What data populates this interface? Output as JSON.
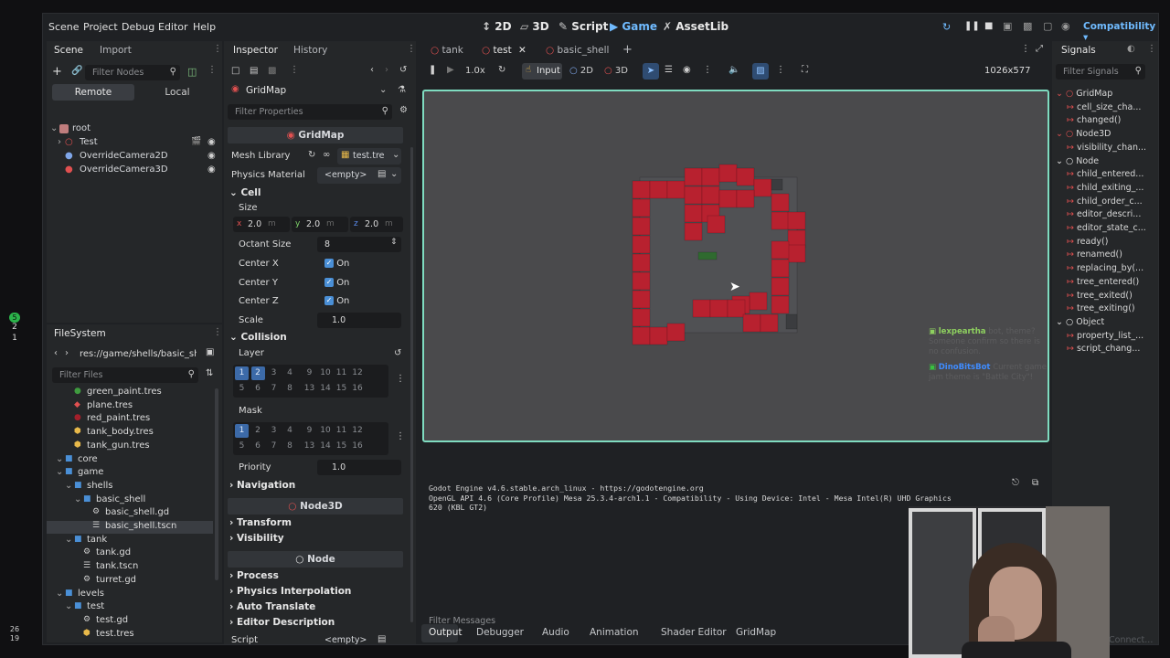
{
  "menu": [
    "Scene",
    "Project",
    "Debug",
    "Editor",
    "Help"
  ],
  "workspaces": [
    {
      "label": "2D",
      "icon": "2d-icon"
    },
    {
      "label": "3D",
      "icon": "3d-icon"
    },
    {
      "label": "Script",
      "icon": "script-icon"
    },
    {
      "label": "Game",
      "icon": "game-icon"
    },
    {
      "label": "AssetLib",
      "icon": "assetlib-icon"
    }
  ],
  "renderer": "Compatibility",
  "scene_dock": {
    "tabs": [
      "Scene",
      "Import"
    ],
    "filter_placeholder": "Filter Nodes",
    "remote_label": "Remote",
    "local_label": "Local",
    "nodes": [
      {
        "label": "root",
        "depth": 0
      },
      {
        "label": "Test",
        "depth": 1
      },
      {
        "label": "OverrideCamera2D",
        "depth": 1
      },
      {
        "label": "OverrideCamera3D",
        "depth": 1
      }
    ]
  },
  "filesystem": {
    "title": "FileSystem",
    "path": "res://game/shells/basic_she",
    "filter_placeholder": "Filter Files",
    "items": [
      {
        "label": "green_paint.tres",
        "depth": 2,
        "kind": "material-green"
      },
      {
        "label": "plane.tres",
        "depth": 2,
        "kind": "mesh"
      },
      {
        "label": "red_paint.tres",
        "depth": 2,
        "kind": "material-red"
      },
      {
        "label": "tank_body.tres",
        "depth": 2,
        "kind": "resource"
      },
      {
        "label": "tank_gun.tres",
        "depth": 2,
        "kind": "resource"
      },
      {
        "label": "core",
        "depth": 1,
        "kind": "folder"
      },
      {
        "label": "game",
        "depth": 1,
        "kind": "folder"
      },
      {
        "label": "shells",
        "depth": 2,
        "kind": "folder"
      },
      {
        "label": "basic_shell",
        "depth": 3,
        "kind": "folder"
      },
      {
        "label": "basic_shell.gd",
        "depth": 4,
        "kind": "script"
      },
      {
        "label": "basic_shell.tscn",
        "depth": 4,
        "kind": "scene",
        "selected": true
      },
      {
        "label": "tank",
        "depth": 2,
        "kind": "folder"
      },
      {
        "label": "tank.gd",
        "depth": 3,
        "kind": "script"
      },
      {
        "label": "tank.tscn",
        "depth": 3,
        "kind": "scene"
      },
      {
        "label": "turret.gd",
        "depth": 3,
        "kind": "script"
      },
      {
        "label": "levels",
        "depth": 1,
        "kind": "folder"
      },
      {
        "label": "test",
        "depth": 2,
        "kind": "folder"
      },
      {
        "label": "test.gd",
        "depth": 3,
        "kind": "script"
      },
      {
        "label": "test.tres",
        "depth": 3,
        "kind": "resource"
      }
    ]
  },
  "inspector": {
    "tabs": [
      "Inspector",
      "History"
    ],
    "object_name": "GridMap",
    "filter_placeholder": "Filter Properties",
    "class_header": "GridMap",
    "mesh_library_label": "Mesh Library",
    "mesh_library_value": "test.tre",
    "physics_material_label": "Physics Material",
    "physics_material_value": "<empty>",
    "cell_section": "Cell",
    "size_label": "Size",
    "size": [
      {
        "axis": "x",
        "value": "2.0",
        "unit": "m"
      },
      {
        "axis": "y",
        "value": "2.0",
        "unit": "m"
      },
      {
        "axis": "z",
        "value": "2.0",
        "unit": "m"
      }
    ],
    "octant_label": "Octant Size",
    "octant_value": "8",
    "center_x_label": "Center X",
    "center_y_label": "Center Y",
    "center_z_label": "Center Z",
    "on_label": "On",
    "scale_label": "Scale",
    "scale_value": "1.0",
    "collision_section": "Collision",
    "layer_label": "Layer",
    "mask_label": "Mask",
    "layer_bits_row1": [
      "1",
      "2",
      "3",
      "4",
      "9",
      "10",
      "11",
      "12"
    ],
    "layer_bits_row2": [
      "5",
      "6",
      "7",
      "8",
      "13",
      "14",
      "15",
      "16"
    ],
    "layer_active": [
      "1",
      "2"
    ],
    "mask_active": [
      "1"
    ],
    "priority_label": "Priority",
    "priority_value": "1.0",
    "navigation_section": "Navigation",
    "node3d_header": "Node3D",
    "transform_section": "Transform",
    "visibility_section": "Visibility",
    "node_header": "Node",
    "process_section": "Process",
    "physics_interp_section": "Physics Interpolation",
    "auto_translate_section": "Auto Translate",
    "editor_desc_section": "Editor Description",
    "script_label": "Script",
    "script_value": "<empty>"
  },
  "scene_tabs": [
    "tank",
    "test",
    "basic_shell"
  ],
  "game_toolbar": {
    "speed": "1.0x",
    "input_label": "Input",
    "mode_2d": "2D",
    "mode_3d": "3D",
    "resolution": "1026x577"
  },
  "chat": [
    {
      "user": "lexpeartha",
      "user_color": "#8ed05f",
      "message": "bot, theme? Someone confirm so there is no confusion."
    },
    {
      "user": "DinoBitsBot",
      "user_color": "#3f8cff",
      "message": "Current game jam theme is \"Battle City\"!"
    }
  ],
  "output": {
    "lines": [
      "Godot Engine v4.6.stable.arch_linux - https://godotengine.org",
      "OpenGL API 4.6 (Core Profile) Mesa 25.3.4-arch1.1 - Compatibility - Using Device: Intel - Mesa Intel(R) UHD Graphics",
      "620 (KBL GT2)"
    ],
    "filter_placeholder": "Filter Messages"
  },
  "bottom_tabs": [
    "Output",
    "Debugger",
    "Audio",
    "Animation",
    "Shader Editor",
    "GridMap"
  ],
  "signals": {
    "title": "Signals",
    "filter_placeholder": "Filter Signals",
    "rows": [
      {
        "label": "GridMap",
        "kind": "class"
      },
      {
        "label": "cell_size_cha...",
        "kind": "signal"
      },
      {
        "label": "changed()",
        "kind": "signal"
      },
      {
        "label": "Node3D",
        "kind": "class"
      },
      {
        "label": "visibility_chan...",
        "kind": "signal"
      },
      {
        "label": "Node",
        "kind": "class"
      },
      {
        "label": "child_entered...",
        "kind": "signal"
      },
      {
        "label": "child_exiting_...",
        "kind": "signal"
      },
      {
        "label": "child_order_c...",
        "kind": "signal"
      },
      {
        "label": "editor_descri...",
        "kind": "signal"
      },
      {
        "label": "editor_state_c...",
        "kind": "signal"
      },
      {
        "label": "ready()",
        "kind": "signal"
      },
      {
        "label": "renamed()",
        "kind": "signal"
      },
      {
        "label": "replacing_by(...",
        "kind": "signal"
      },
      {
        "label": "tree_entered()",
        "kind": "signal"
      },
      {
        "label": "tree_exited()",
        "kind": "signal"
      },
      {
        "label": "tree_exiting()",
        "kind": "signal"
      },
      {
        "label": "Object",
        "kind": "class"
      },
      {
        "label": "property_list_...",
        "kind": "signal"
      },
      {
        "label": "script_chang...",
        "kind": "signal"
      }
    ]
  },
  "connect_label": "Connect...",
  "side_badges": [
    "5",
    "2",
    "1"
  ],
  "clock": [
    "26",
    "19"
  ],
  "colors": {
    "accent": "#70bbff",
    "wall": "#b8212f",
    "floor": "#505154",
    "viewport_border": "#7fdcc0"
  }
}
